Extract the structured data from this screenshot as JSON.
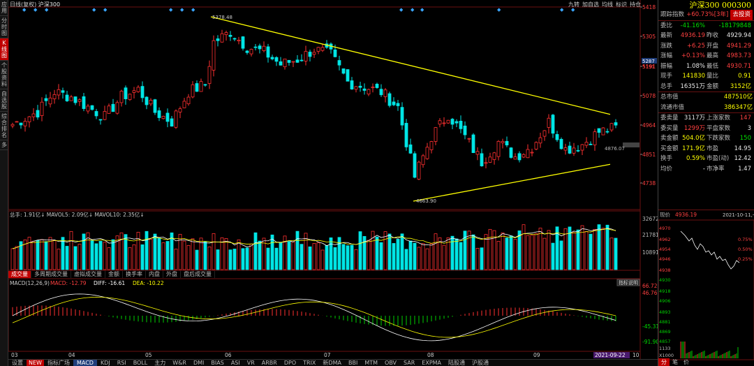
{
  "left_tabs": [
    "应用",
    "分时图",
    "K线图",
    "个股资料",
    "自选股",
    "综合排名",
    "多"
  ],
  "left_active": 2,
  "header": {
    "period": "日线(复权)",
    "name": "沪深300"
  },
  "toolbar": [
    "九转",
    "加自选",
    "均线",
    "标识",
    "持仓"
  ],
  "price_axis": [
    "5418",
    "5305",
    "5191",
    "5078",
    "4964",
    "4851",
    "4738"
  ],
  "price_axis_tags": {
    "cur": "5287",
    "cur2": "5191",
    "side": "4876.07"
  },
  "annotations": {
    "high": "5378.48",
    "low": "4663.90"
  },
  "volume": {
    "label": "总手",
    "val": "1.91亿",
    "ma5_label": "MAVOL5",
    "ma5": "2.09亿",
    "ma10_label": "MAVOL10",
    "ma10": "2.35亿",
    "axis": [
      "32672",
      "21781",
      "10891"
    ]
  },
  "vol_tabs": [
    "成交量",
    "多周期成交量",
    "虚拟成交量",
    "金额",
    "换手率",
    "内盘",
    "外盘",
    "盘后成交量"
  ],
  "macd": {
    "label": "MACD(12,26,9)",
    "macd": "MACD: -12.79",
    "diff": "DIFF: -16.61",
    "dea": "DEA: -10.22",
    "axis": [
      "66.72",
      "46.76",
      "-45.31",
      "-91.90"
    ],
    "help": "指标说明"
  },
  "xaxis": [
    "03",
    "04",
    "05",
    "06",
    "07",
    "08",
    "09",
    "10"
  ],
  "date_tag": "2021-09-22",
  "bottom_tabs": [
    "设置",
    "NEW",
    "指标广场",
    "MACD",
    "KDJ",
    "RSI",
    "BOLL",
    "主力",
    "W&R",
    "DMI",
    "BIAS",
    "ASI",
    "VR",
    "ARBR",
    "DPO",
    "TRIX",
    "新DMA",
    "BBI",
    "MTM",
    "OBV",
    "SAR",
    "EXPMA",
    "陆股通",
    "沪股通"
  ],
  "right": {
    "title": "沪深300 000300",
    "track": {
      "k": "跟踪指数",
      "v": "+60.73%[3年]",
      "btn": "去投资"
    },
    "rows1": [
      [
        {
          "k": "委比",
          "v": "-41.16%",
          "c": "grn"
        },
        {
          "k": "",
          "v": "-18179848",
          "c": "grn"
        }
      ],
      [
        {
          "k": "最新",
          "v": "4936.19",
          "c": "red"
        },
        {
          "k": "昨收",
          "v": "4929.94",
          "c": "wht"
        }
      ],
      [
        {
          "k": "涨跌",
          "v": "+6.25",
          "c": "red"
        },
        {
          "k": "开盘",
          "v": "4941.29",
          "c": "red"
        }
      ],
      [
        {
          "k": "涨幅",
          "v": "+0.13%",
          "c": "red"
        },
        {
          "k": "最高",
          "v": "4983.73",
          "c": "red"
        }
      ],
      [
        {
          "k": "振幅",
          "v": "1.08%",
          "c": "wht"
        },
        {
          "k": "最低",
          "v": "4930.71",
          "c": "red"
        }
      ],
      [
        {
          "k": "现手",
          "v": "141830",
          "c": "yel"
        },
        {
          "k": "量比",
          "v": "0.91",
          "c": "yel"
        }
      ],
      [
        {
          "k": "总手",
          "v": "16351万",
          "c": "wht"
        },
        {
          "k": "金额",
          "v": "3152亿",
          "c": "yel"
        }
      ]
    ],
    "rows2": [
      {
        "k": "总市值",
        "v": "487510亿",
        "c": "yel"
      },
      {
        "k": "流通市值",
        "v": "386347亿",
        "c": "yel"
      }
    ],
    "rows3": [
      [
        {
          "k": "委卖量",
          "v": "3117万",
          "c": "wht"
        },
        {
          "k": "上涨家数",
          "v": "147",
          "c": "red"
        }
      ],
      [
        {
          "k": "委买量",
          "v": "1299万",
          "c": "red"
        },
        {
          "k": "平盘家数",
          "v": "3",
          "c": "wht"
        }
      ],
      [
        {
          "k": "卖金额",
          "v": "504.0亿",
          "c": "yel"
        },
        {
          "k": "下跌家数",
          "v": "150",
          "c": "grn"
        }
      ],
      [
        {
          "k": "买金额",
          "v": "171.9亿",
          "c": "yel"
        },
        {
          "k": "市盈",
          "v": "14.95",
          "c": "wht"
        }
      ],
      [
        {
          "k": "换手",
          "v": "0.59%",
          "c": "yel"
        },
        {
          "k": "市盈(动)",
          "v": "12.42",
          "c": "wht"
        }
      ],
      [
        {
          "k": "均价",
          "v": "-",
          "c": "wht"
        },
        {
          "k": "市净率",
          "v": "1.47",
          "c": "wht"
        }
      ]
    ],
    "mini": {
      "label": "现价",
      "val": "4936.19",
      "date": "2021-10-11,一",
      "axis_l": [
        "4970",
        "4962",
        "4954",
        "4946",
        "4938",
        "4930",
        "4918",
        "4906",
        "4893",
        "4881",
        "4869",
        "4857",
        "1133",
        "X1000"
      ],
      "axis_r": [
        "0.75%",
        "0.50%",
        "0.25%"
      ],
      "tabs": [
        "分",
        "笔",
        "价"
      ]
    }
  },
  "colors": {
    "up": "#ff3030",
    "down": "#00e5e5",
    "trend": "#ffff00",
    "ma1": "#ffffff",
    "ma2": "#ffff00"
  }
}
